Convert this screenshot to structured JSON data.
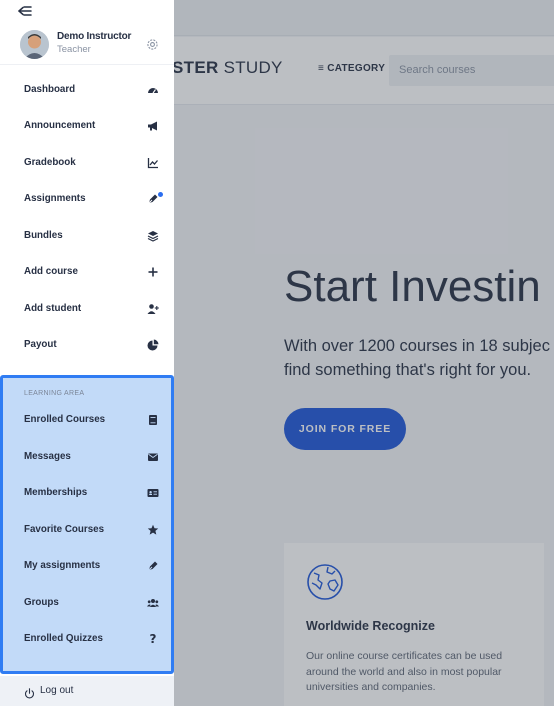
{
  "header": {
    "logo_bold": "STER",
    "logo_light": "STUDY",
    "category_label": "≡ CATEGORY",
    "search_placeholder": "Search courses"
  },
  "hero": {
    "title": "Start Investin",
    "subtitle_line1": "With over 1200 courses in 18 subjec",
    "subtitle_line2": "find something that's right for you.",
    "cta_label": "JOIN FOR FREE"
  },
  "feature_card": {
    "icon": "globe-icon",
    "title": "Worldwide Recognize",
    "text": "Our online course certificates can be used around the world and also in most popular universities and companies."
  },
  "profile": {
    "name": "Demo Instructor",
    "role": "Teacher"
  },
  "menu": [
    {
      "label": "Dashboard",
      "icon": "dashboard-icon"
    },
    {
      "label": "Announcement",
      "icon": "megaphone-icon"
    },
    {
      "label": "Gradebook",
      "icon": "chart-icon"
    },
    {
      "label": "Assignments",
      "icon": "pen-icon"
    },
    {
      "label": "Bundles",
      "icon": "layers-icon"
    },
    {
      "label": "Add course",
      "icon": "plus-icon"
    },
    {
      "label": "Add student",
      "icon": "add-user-icon"
    },
    {
      "label": "Payout",
      "icon": "pie-chart-icon"
    }
  ],
  "learning_area": {
    "title": "LEARNING AREA",
    "items": [
      {
        "label": "Enrolled Courses",
        "icon": "book-icon"
      },
      {
        "label": "Messages",
        "icon": "envelope-icon"
      },
      {
        "label": "Memberships",
        "icon": "id-card-icon"
      },
      {
        "label": "Favorite Courses",
        "icon": "star-icon"
      },
      {
        "label": "My assignments",
        "icon": "pen-icon"
      },
      {
        "label": "Groups",
        "icon": "users-icon"
      },
      {
        "label": "Enrolled Quizzes",
        "icon": "question-icon"
      }
    ]
  },
  "logout": {
    "label": "Log out"
  },
  "colors": {
    "accent": "#2f7cf3",
    "highlight_bg": "#c2daf8",
    "cta": "#1d56d9",
    "notification_dot": "#2b6ef0",
    "text": "#273044"
  }
}
